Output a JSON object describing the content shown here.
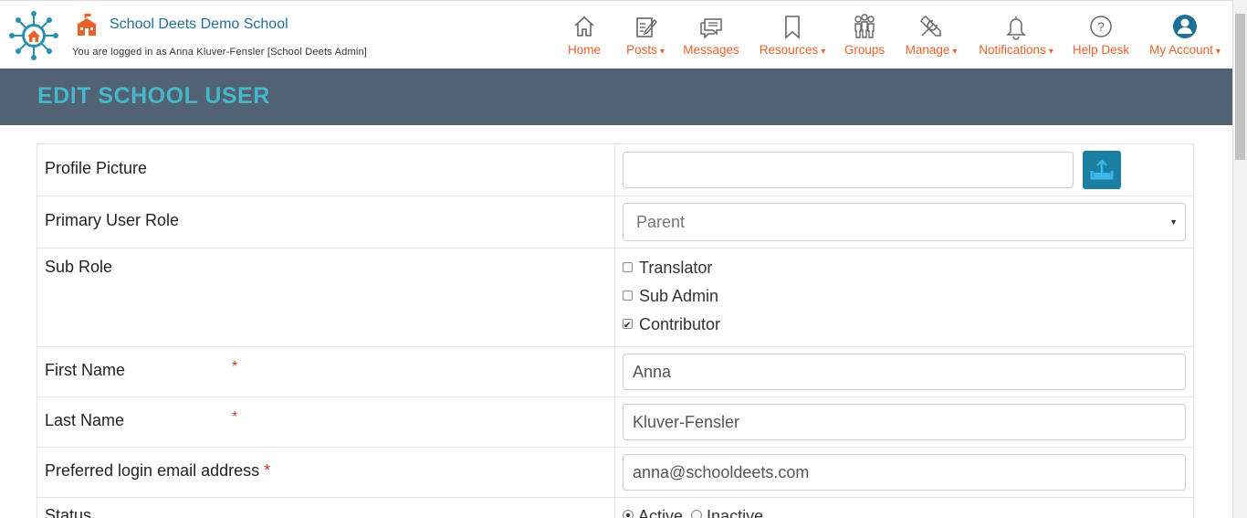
{
  "header": {
    "school_name": "School Deets Demo School",
    "logged_in_text": "You are logged in as Anna Kluver-Fensler [School Deets Admin]"
  },
  "nav": {
    "items": [
      {
        "label": "Home",
        "icon": "home-icon",
        "dropdown": false
      },
      {
        "label": "Posts",
        "icon": "posts-icon",
        "dropdown": true
      },
      {
        "label": "Messages",
        "icon": "messages-icon",
        "dropdown": false
      },
      {
        "label": "Resources",
        "icon": "bookmark-icon",
        "dropdown": true
      },
      {
        "label": "Groups",
        "icon": "groups-icon",
        "dropdown": false
      },
      {
        "label": "Manage",
        "icon": "tools-icon",
        "dropdown": true
      },
      {
        "label": "Notifications",
        "icon": "bell-icon",
        "dropdown": true
      },
      {
        "label": "Help Desk",
        "icon": "help-icon",
        "dropdown": false
      },
      {
        "label": "My Account",
        "icon": "user-icon",
        "dropdown": true
      }
    ],
    "caret": "▾"
  },
  "page": {
    "title": "EDIT SCHOOL USER"
  },
  "form": {
    "profile_picture": {
      "label": "Profile Picture",
      "value": ""
    },
    "primary_role": {
      "label": "Primary User Role",
      "value": "Parent",
      "caret": "▼"
    },
    "sub_role": {
      "label": "Sub Role",
      "options": [
        {
          "label": "Translator",
          "checked": false
        },
        {
          "label": "Sub Admin",
          "checked": false
        },
        {
          "label": "Contributor",
          "checked": true
        }
      ]
    },
    "first_name": {
      "label": "First Name",
      "required": "*",
      "value": "Anna"
    },
    "last_name": {
      "label": "Last Name",
      "required": "*",
      "value": "Kluver-Fensler"
    },
    "email": {
      "label": "Preferred login email address",
      "required": "*",
      "value": "anna@schooldeets.com"
    },
    "status": {
      "label": "Status",
      "options": [
        {
          "label": "Active",
          "checked": true
        },
        {
          "label": "Inactive",
          "checked": false
        }
      ]
    }
  },
  "colors": {
    "nav_accent": "#e8622a",
    "title_bar": "#506273",
    "title_text": "#46b6c8",
    "school_name": "#1f6f96",
    "upload_button": "#1a7fa0",
    "required": "#c0392b"
  }
}
